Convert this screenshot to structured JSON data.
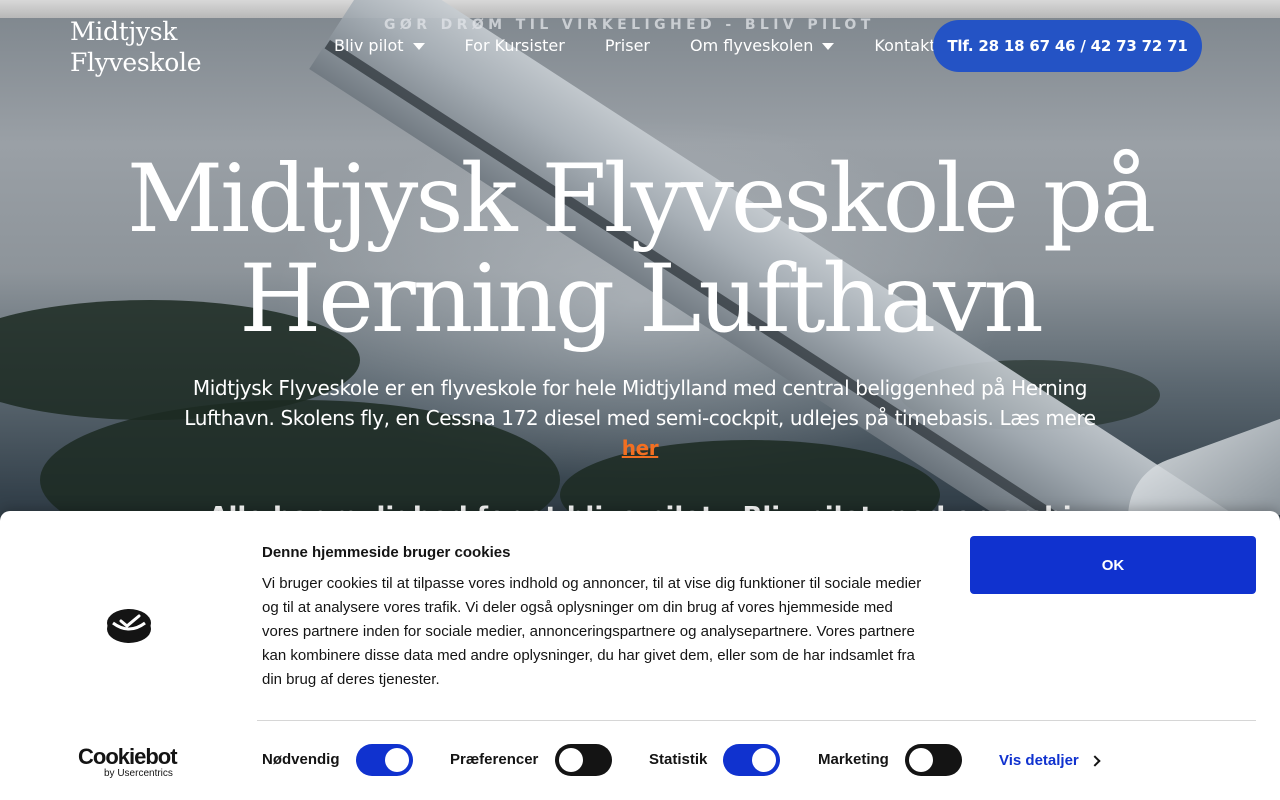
{
  "header": {
    "logo_line1": "Midtjysk",
    "logo_line2": "Flyveskole",
    "tagline": "GØR DRØM TIL VIRKELIGHED - BLIV PILOT",
    "nav": [
      {
        "label": "Bliv pilot",
        "dropdown": true
      },
      {
        "label": "For Kursister",
        "dropdown": false
      },
      {
        "label": "Priser",
        "dropdown": false
      },
      {
        "label": "Om flyveskolen",
        "dropdown": true
      },
      {
        "label": "Kontakt",
        "dropdown": false
      }
    ],
    "phone_button": "Tlf. 28 18 67 46 / 42 73 72 71"
  },
  "hero": {
    "title_line1": "Midtjysk Flyveskole på",
    "title_line2": "Herning Lufthavn",
    "text": "Midtjysk Flyveskole er en flyveskole for hele Midtjylland med central beliggenhed på Herning Lufthavn. Skolens fly, en Cessna 172 diesel med semi-cockpit, udlejes på timebasis. Læs mere",
    "link": "her",
    "second_line": "Alle har mulighed for at blive pilot - Bliv pilot med en ambi"
  },
  "cookie_banner": {
    "title": "Denne hjemmeside bruger cookies",
    "body": "Vi bruger cookies til at tilpasse vores indhold og annoncer, til at vise dig funktioner til sociale medier og til at analysere vores trafik. Vi deler også oplysninger om din brug af vores hjemmeside med vores partnere inden for sociale medier, annonceringspartnere og analysepartnere. Vores partnere kan kombinere disse data med andre oplysninger, du har givet dem, eller som de har indsamlet fra din brug af deres tjenester.",
    "ok_button": "OK",
    "brand_name": "Cookiebot",
    "brand_sub": "by Usercentrics",
    "toggles": [
      {
        "label": "Nødvendig",
        "on": true
      },
      {
        "label": "Præferencer",
        "on": false
      },
      {
        "label": "Statistik",
        "on": true
      },
      {
        "label": "Marketing",
        "on": false
      }
    ],
    "details_link": "Vis detaljer",
    "accent_color": "#1032cf"
  }
}
